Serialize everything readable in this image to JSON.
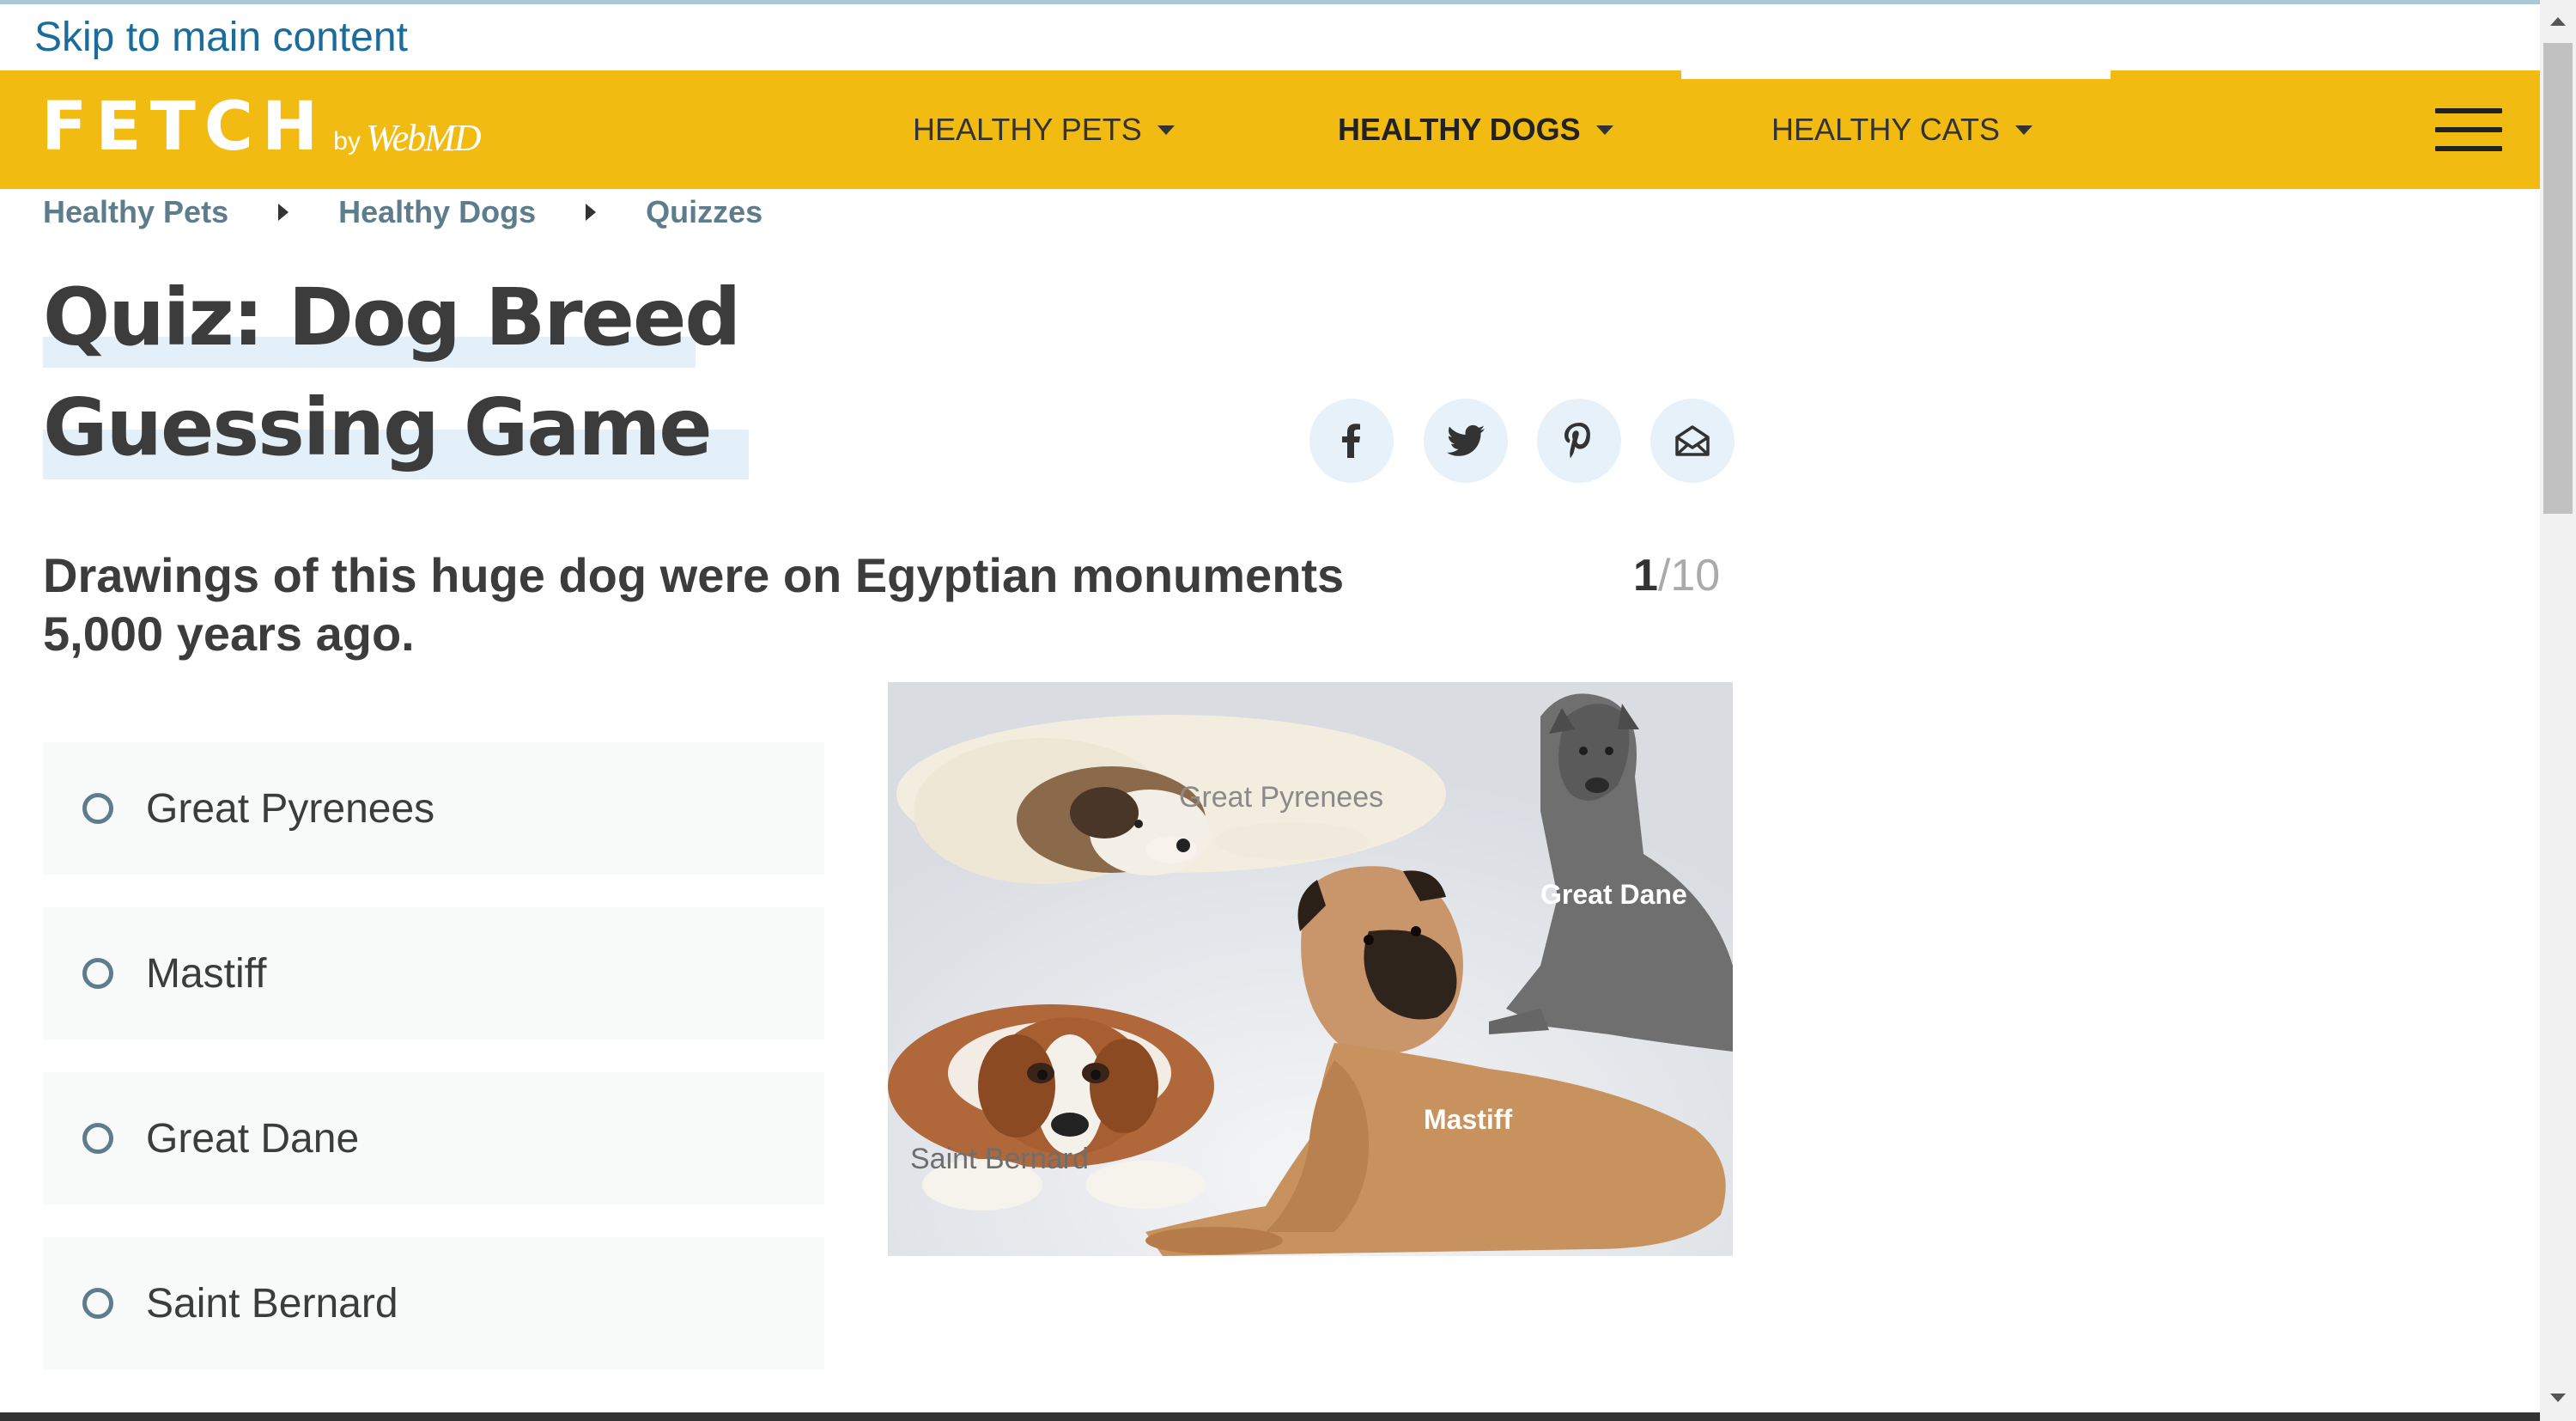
{
  "skip_link": "Skip to main content",
  "header": {
    "logo": {
      "fetch": "FETCH",
      "by": "by",
      "webmd": "WebMD"
    },
    "nav": [
      {
        "label": "HEALTHY PETS",
        "active": false
      },
      {
        "label": "HEALTHY DOGS",
        "active": true
      },
      {
        "label": "HEALTHY CATS",
        "active": false
      }
    ],
    "menu_icon": "hamburger-menu-icon",
    "accent_color": "#f2bb11"
  },
  "breadcrumb": [
    "Healthy Pets",
    "Healthy Dogs",
    "Quizzes"
  ],
  "page_title": "Quiz: Dog Breed Guessing Game",
  "share": [
    {
      "icon": "facebook-icon"
    },
    {
      "icon": "twitter-icon"
    },
    {
      "icon": "pinterest-icon"
    },
    {
      "icon": "email-icon"
    }
  ],
  "quiz": {
    "question": "Drawings of this huge dog were on Egyptian monuments 5,000 years ago.",
    "current": "1",
    "separator": "/",
    "total": "10",
    "options": [
      "Great Pyrenees",
      "Mastiff",
      "Great Dane",
      "Saint Bernard"
    ],
    "image_labels": {
      "great_pyrenees": "Great Pyrenees",
      "great_dane": "Great Dane",
      "mastiff": "Mastiff",
      "saint_bernard": "Saint Bernard"
    }
  }
}
